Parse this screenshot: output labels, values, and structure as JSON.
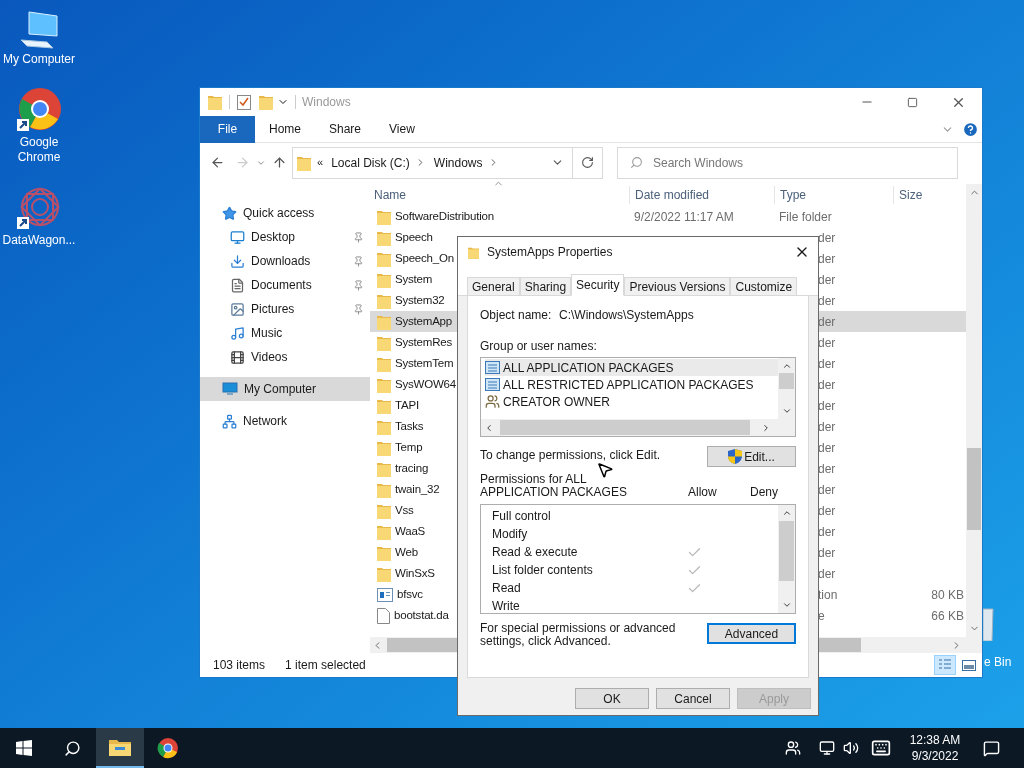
{
  "desktop_icons": [
    {
      "label": "My Computer",
      "kind": "computer"
    },
    {
      "label": "Google Chrome",
      "kind": "chrome"
    },
    {
      "label": "DataWagon...",
      "kind": "datawagon"
    }
  ],
  "recycle_bin": {
    "label": "e Bin"
  },
  "explorer": {
    "title": "Windows",
    "ribbon_tabs": [
      {
        "label": "File",
        "kind": "file"
      },
      {
        "label": "Home",
        "kind": "tab"
      },
      {
        "label": "Share",
        "kind": "tab"
      },
      {
        "label": "View",
        "kind": "tab"
      }
    ],
    "address": {
      "overflow": "«",
      "segments": [
        "Local Disk (C:)",
        "Windows"
      ]
    },
    "search": {
      "placeholder": "Search Windows"
    },
    "nav": [
      {
        "label": "Quick access",
        "kind": "star",
        "pinned": false,
        "selected": false,
        "children": [
          {
            "label": "Desktop",
            "kind": "desktop",
            "pinned": true,
            "selected": false
          },
          {
            "label": "Downloads",
            "kind": "download",
            "pinned": true,
            "selected": false
          },
          {
            "label": "Documents",
            "kind": "document",
            "pinned": true,
            "selected": false
          },
          {
            "label": "Pictures",
            "kind": "picture",
            "pinned": true,
            "selected": false
          },
          {
            "label": "Music",
            "kind": "music",
            "pinned": false,
            "selected": false
          },
          {
            "label": "Videos",
            "kind": "video",
            "pinned": false,
            "selected": false
          }
        ]
      },
      {
        "label": "My Computer",
        "kind": "computer",
        "pinned": false,
        "selected": true
      },
      {
        "label": "Network",
        "kind": "network",
        "pinned": false,
        "selected": false
      }
    ],
    "columns": [
      "Name",
      "Date modified",
      "Type",
      "Size"
    ],
    "rows": [
      {
        "name": "SoftwareDistribution",
        "kind": "folder",
        "date": "9/2/2022 11:17 AM",
        "type": "File folder",
        "selected": false
      },
      {
        "name": "Speech",
        "kind": "folder",
        "type": "der",
        "selected": false
      },
      {
        "name": "Speech_On",
        "kind": "folder",
        "type": "der",
        "selected": false
      },
      {
        "name": "System",
        "kind": "folder",
        "type": "der",
        "selected": false
      },
      {
        "name": "System32",
        "kind": "folder",
        "type": "der",
        "selected": false
      },
      {
        "name": "SystemApp",
        "kind": "folder",
        "type": "der",
        "selected": true
      },
      {
        "name": "SystemRes",
        "kind": "folder",
        "type": "der",
        "selected": false
      },
      {
        "name": "SystemTem",
        "kind": "folder",
        "type": "der",
        "selected": false
      },
      {
        "name": "SysWOW64",
        "kind": "folder",
        "type": "der",
        "selected": false
      },
      {
        "name": "TAPI",
        "kind": "folder",
        "type": "der",
        "selected": false
      },
      {
        "name": "Tasks",
        "kind": "folder",
        "type": "der",
        "selected": false
      },
      {
        "name": "Temp",
        "kind": "folder",
        "type": "der",
        "selected": false
      },
      {
        "name": "tracing",
        "kind": "folder",
        "type": "der",
        "selected": false
      },
      {
        "name": "twain_32",
        "kind": "folder",
        "type": "der",
        "selected": false
      },
      {
        "name": "Vss",
        "kind": "folder",
        "type": "der",
        "selected": false
      },
      {
        "name": "WaaS",
        "kind": "folder",
        "type": "der",
        "selected": false
      },
      {
        "name": "Web",
        "kind": "folder",
        "type": "der",
        "selected": false
      },
      {
        "name": "WinSxS",
        "kind": "folder",
        "type": "der",
        "selected": false
      },
      {
        "name": "bfsvc",
        "kind": "app",
        "type": "tion",
        "size": "80 KB",
        "selected": false
      },
      {
        "name": "bootstat.da",
        "kind": "file",
        "type": "e",
        "size": "66 KB",
        "selected": false
      }
    ],
    "status": {
      "count": "103 items",
      "selection": "1 item selected"
    }
  },
  "dialog": {
    "title": "SystemApps Properties",
    "tabs": [
      {
        "label": "General",
        "selected": false
      },
      {
        "label": "Sharing",
        "selected": false
      },
      {
        "label": "Security",
        "selected": true
      },
      {
        "label": "Previous Versions",
        "selected": false
      },
      {
        "label": "Customize",
        "selected": false
      }
    ],
    "object_name_label": "Object name:",
    "object_name": "C:\\Windows\\SystemApps",
    "groups_label": "Group or user names:",
    "groups": [
      {
        "name": "ALL APPLICATION PACKAGES",
        "kind": "package",
        "selected": true
      },
      {
        "name": "ALL RESTRICTED APPLICATION PACKAGES",
        "kind": "package",
        "selected": false
      },
      {
        "name": "CREATOR OWNER",
        "kind": "user",
        "selected": false
      }
    ],
    "change_hint": "To change permissions, click Edit.",
    "edit_button": "Edit...",
    "permissions_label": "Permissions for ALL APPLICATION PACKAGES",
    "allow_header": "Allow",
    "deny_header": "Deny",
    "permissions": [
      {
        "name": "Full control",
        "allow": false,
        "deny": false
      },
      {
        "name": "Modify",
        "allow": false,
        "deny": false
      },
      {
        "name": "Read & execute",
        "allow": true,
        "deny": false
      },
      {
        "name": "List folder contents",
        "allow": true,
        "deny": false
      },
      {
        "name": "Read",
        "allow": true,
        "deny": false
      },
      {
        "name": "Write",
        "allow": false,
        "deny": false
      }
    ],
    "advanced_hint": "For special permissions or advanced settings, click Advanced.",
    "advanced_button": "Advanced",
    "buttons": [
      {
        "label": "OK",
        "disabled": false
      },
      {
        "label": "Cancel",
        "disabled": false
      },
      {
        "label": "Apply",
        "disabled": true
      }
    ]
  },
  "taskbar": {
    "apps": [
      {
        "kind": "explorer",
        "active": true
      },
      {
        "kind": "chrome",
        "active": false
      }
    ],
    "time": "12:38 AM",
    "date": "9/3/2022"
  }
}
